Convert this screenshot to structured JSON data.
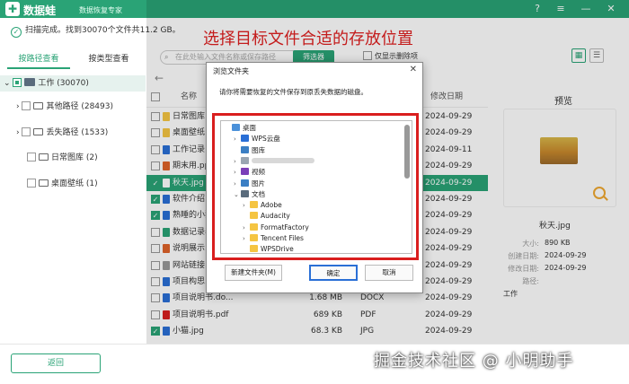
{
  "app": {
    "name": "数据蛙",
    "subtitle": "数据恢复专家",
    "logo_char": "✚",
    "brand_color": "#2aa376"
  },
  "titlebar_buttons": {
    "help": "?",
    "menu": "≡",
    "min": "—",
    "close": "✕"
  },
  "status": {
    "text": "扫描完成。找到30070个文件共11.2 GB。"
  },
  "headline": "选择目标文件合适的存放位置",
  "tabs": {
    "by_path": "按路径查看",
    "by_type": "按类型查看"
  },
  "search": {
    "placeholder": "在此处输入文件名称或保存路径",
    "filter_label": "筛选器",
    "only_deleted": "仅显示删除项"
  },
  "tree": {
    "root": "工作 (30070)",
    "items": [
      {
        "label": "其他路径 (28493)",
        "expand": "›"
      },
      {
        "label": "丢失路径 (1533)",
        "expand": "›"
      },
      {
        "label": "日常图库 (2)",
        "expand": ""
      },
      {
        "label": "桌面壁纸 (1)",
        "expand": ""
      }
    ]
  },
  "columns": {
    "name": "名称",
    "size": "大小",
    "type": "类型",
    "date": "修改日期"
  },
  "files": [
    {
      "name": "日常图库",
      "size": "",
      "type": "",
      "date": "2024-09-29",
      "checked": false,
      "icon_color": "#f5c542"
    },
    {
      "name": "桌面壁纸",
      "size": "",
      "type": "",
      "date": "2024-09-29",
      "checked": false,
      "icon_color": "#f5c542"
    },
    {
      "name": "工作记录1",
      "size": "",
      "type": "",
      "date": "2024-09-11",
      "checked": false,
      "icon_color": "#2a6fd6"
    },
    {
      "name": "期末用.ppt",
      "size": "",
      "type": "",
      "date": "2024-09-29",
      "checked": false,
      "icon_color": "#e0632a"
    },
    {
      "name": "秋天.jpg",
      "size": "",
      "type": "",
      "date": "2024-09-29",
      "checked": true,
      "icon_color": "#ffffff"
    },
    {
      "name": "软件介绍",
      "size": "",
      "type": "",
      "date": "2024-09-29",
      "checked": true,
      "icon_color": "#2a6fd6"
    },
    {
      "name": "熟睡的小猫",
      "size": "",
      "type": "",
      "date": "2024-09-29",
      "checked": true,
      "icon_color": "#2a6fd6"
    },
    {
      "name": "数据记录表",
      "size": "",
      "type": "",
      "date": "2024-09-29",
      "checked": false,
      "icon_color": "#2aa376"
    },
    {
      "name": "说明展示.p",
      "size": "",
      "type": "",
      "date": "2024-09-29",
      "checked": false,
      "icon_color": "#e0632a"
    },
    {
      "name": "网站链接.t",
      "size": "",
      "type": "",
      "date": "2024-09-29",
      "checked": false,
      "icon_color": "#999999"
    },
    {
      "name": "项目构思.docx",
      "size": "",
      "type": "",
      "date": "2024-09-29",
      "checked": false,
      "icon_color": "#2a6fd6"
    },
    {
      "name": "项目说明书.do...",
      "size": "1.68 MB",
      "type": "DOCX",
      "date": "2024-09-29",
      "checked": false,
      "icon_color": "#2a6fd6"
    },
    {
      "name": "项目说明书.pdf",
      "size": "689 KB",
      "type": "PDF",
      "date": "2024-09-29",
      "checked": false,
      "icon_color": "#d91e1e"
    },
    {
      "name": "小猫.jpg",
      "size": "68.3 KB",
      "type": "JPG",
      "date": "2024-09-29",
      "checked": true,
      "icon_color": "#2a6fd6"
    }
  ],
  "preview": {
    "title": "预览",
    "filename": "秋天.jpg",
    "size_label": "大小:",
    "size": "890 KB",
    "created_label": "创建日期:",
    "created": "2024-09-29",
    "modified_label": "修改日期:",
    "modified": "2024-09-29",
    "path_label": "路径:",
    "path": "工作"
  },
  "back_button": "返回",
  "watermark": "掘金技术社区 @ 小明助手",
  "dialog": {
    "title": "浏览文件夹",
    "close": "✕",
    "description": "请你将需要恢复的文件保存到原丢失数据的磁盘。",
    "tree": [
      {
        "label": "桌面",
        "arrow": "",
        "indent": 0,
        "icon": "#4a90d9"
      },
      {
        "label": "WPS云盘",
        "arrow": "›",
        "indent": 1,
        "icon": "#2a6fd6"
      },
      {
        "label": "图库",
        "arrow": "",
        "indent": 1,
        "icon": "#3b7fc4"
      },
      {
        "label": "",
        "arrow": "›",
        "indent": 1,
        "icon": "#9aa6b2"
      },
      {
        "label": "视频",
        "arrow": "›",
        "indent": 1,
        "icon": "#7b3fb8"
      },
      {
        "label": "图片",
        "arrow": "›",
        "indent": 1,
        "icon": "#3b7fc4"
      },
      {
        "label": "文档",
        "arrow": "⌄",
        "indent": 1,
        "icon": "#5a6b7c"
      },
      {
        "label": "Adobe",
        "arrow": "›",
        "indent": 2,
        "icon": "#f5c542"
      },
      {
        "label": "Audacity",
        "arrow": "",
        "indent": 2,
        "icon": "#f5c542"
      },
      {
        "label": "FormatFactory",
        "arrow": "›",
        "indent": 2,
        "icon": "#f5c542"
      },
      {
        "label": "Tencent Files",
        "arrow": "›",
        "indent": 2,
        "icon": "#f5c542"
      },
      {
        "label": "WPSDrive",
        "arrow": "",
        "indent": 2,
        "icon": "#f5c542"
      }
    ],
    "new_folder": "新建文件夹(M)",
    "ok": "确定",
    "cancel": "取消"
  }
}
